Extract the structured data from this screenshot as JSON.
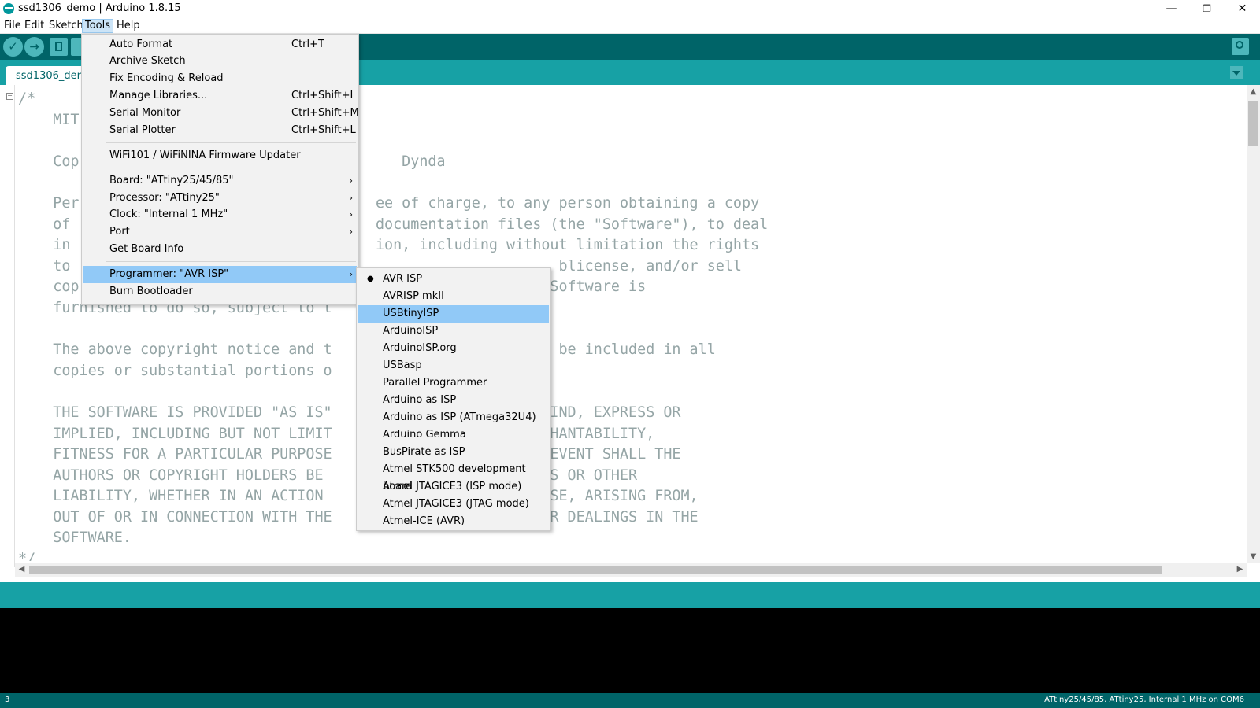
{
  "window": {
    "title": "ssd1306_demo | Arduino 1.8.15",
    "minimize": "—",
    "maximize": "❐",
    "close": "✕"
  },
  "menubar": {
    "items": [
      "File",
      "Edit",
      "Sketch",
      "Tools",
      "Help"
    ]
  },
  "toolbar": {
    "verify_icon": "✓",
    "upload_icon": "→"
  },
  "tab": {
    "label": "ssd1306_demo"
  },
  "editor": {
    "fold_icon": "−",
    "lines": [
      "/*",
      "    MIT",
      "",
      "    Cop                                     Dynda",
      "",
      "    Per                                  ee of charge, to any person obtaining a copy",
      "    of                                   documentation files (the \"Software\"), to deal",
      "    in                                   ion, including without limitation the rights",
      "    to                                                        blicense, and/or sell",
      "    cop                                                  the Software is",
      "    furnished to do so, subject to t                 ns:",
      "",
      "    The above copyright notice and t                  e shall be included in all",
      "    copies or substantial portions o",
      "",
      "    THE SOFTWARE IS PROVIDED \"AS IS\"                  T ANY KIND, EXPRESS OR",
      "    IMPLIED, INCLUDING BUT NOT LIMIT                  OF MERCHANTABILITY,",
      "    FITNESS FOR A PARTICULAR PURPOSE                   IN NO EVENT SHALL THE",
      "    AUTHORS OR COPYRIGHT HOLDERS BE                    DAMAGES OR OTHER",
      "    LIABILITY, WHETHER IN AN ACTION                   OTHERWISE, ARISING FROM,",
      "    OUT OF OR IN CONNECTION WITH THE                  OR OTHER DEALINGS IN THE",
      "    SOFTWARE.",
      "*/"
    ]
  },
  "tools_menu": {
    "items": [
      {
        "label": "Auto Format",
        "shortcut": "Ctrl+T"
      },
      {
        "label": "Archive Sketch",
        "shortcut": ""
      },
      {
        "label": "Fix Encoding & Reload",
        "shortcut": ""
      },
      {
        "label": "Manage Libraries...",
        "shortcut": "Ctrl+Shift+I"
      },
      {
        "label": "Serial Monitor",
        "shortcut": "Ctrl+Shift+M"
      },
      {
        "label": "Serial Plotter",
        "shortcut": "Ctrl+Shift+L"
      },
      {
        "label": "WiFi101 / WiFiNINA Firmware Updater",
        "shortcut": ""
      },
      {
        "label": "Board: \"ATtiny25/45/85\"",
        "shortcut": ""
      },
      {
        "label": "Processor: \"ATtiny25\"",
        "shortcut": ""
      },
      {
        "label": "Clock: \"Internal 1 MHz\"",
        "shortcut": ""
      },
      {
        "label": "Port",
        "shortcut": ""
      },
      {
        "label": "Get Board Info",
        "shortcut": ""
      },
      {
        "label": "Programmer: \"AVR ISP\"",
        "shortcut": ""
      },
      {
        "label": "Burn Bootloader",
        "shortcut": ""
      }
    ],
    "submenu_arrow": "›"
  },
  "programmer_menu": {
    "selected_marker": "●",
    "items": [
      "AVR ISP",
      "AVRISP mkII",
      "USBtinyISP",
      "ArduinoISP",
      "ArduinoISP.org",
      "USBasp",
      "Parallel Programmer",
      "Arduino as ISP",
      "Arduino as ISP (ATmega32U4)",
      "Arduino Gemma",
      "BusPirate as ISP",
      "Atmel STK500 development board",
      "Atmel JTAGICE3 (ISP mode)",
      "Atmel JTAGICE3 (JTAG mode)",
      "Atmel-ICE (AVR)"
    ],
    "selected": "AVR ISP",
    "hovered": "USBtinyISP"
  },
  "scroll": {
    "up": "▲",
    "down": "▼",
    "left": "◀",
    "right": "▶"
  },
  "status": {
    "line_number": "3",
    "board_info": "ATtiny25/45/85, ATtiny25, Internal 1 MHz on COM6"
  }
}
